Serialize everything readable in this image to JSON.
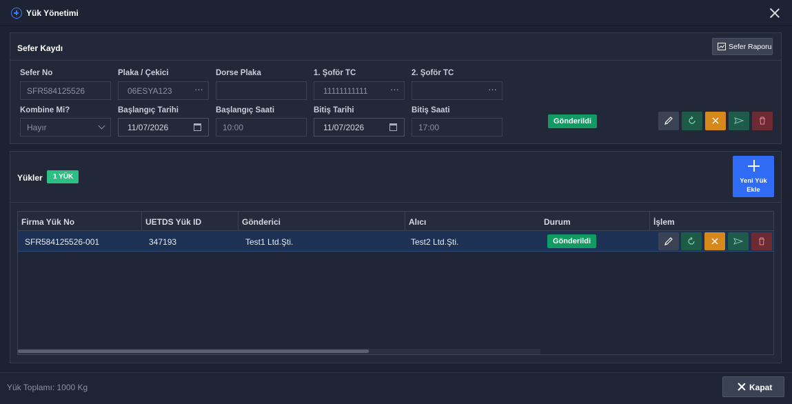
{
  "window": {
    "title": "Yük Yönetimi",
    "icon": "plus-circle-icon"
  },
  "sefer": {
    "section_title": "Sefer Kaydı",
    "report_button": "Sefer Raporu",
    "fields": {
      "sefer_no": {
        "label": "Sefer No",
        "value": "SFR584125526"
      },
      "plaka": {
        "label": "Plaka / Çekici",
        "value": "06ESYA123"
      },
      "dorse": {
        "label": "Dorse Plaka",
        "value": ""
      },
      "sofor1": {
        "label": "1. Şoför TC",
        "value": "11111111111"
      },
      "sofor2": {
        "label": "2. Şoför TC",
        "value": ""
      },
      "kombine": {
        "label": "Kombine Mi?",
        "value": "Hayır"
      },
      "bas_tarih": {
        "label": "Başlangıç Tarihi",
        "value": "11/07/2026"
      },
      "bas_saat": {
        "label": "Başlangıç Saati",
        "value": "10:00"
      },
      "bit_tarih": {
        "label": "Bitiş Tarihi",
        "value": "11/07/2026"
      },
      "bit_saat": {
        "label": "Bitiş Saati",
        "value": "17:00"
      }
    },
    "status": "Gönderildi"
  },
  "yukler": {
    "section_title": "Yükler",
    "count_badge": "1 YÜK",
    "new_button": "Yeni Yük Ekle",
    "columns": [
      "Firma Yük No",
      "UETDS Yük ID",
      "Gönderici",
      "Alıcı",
      "Durum",
      "İşlem"
    ],
    "rows": [
      {
        "firma_yuk_no": "SFR584125526-001",
        "uetds_id": "347193",
        "gonderici": "Test1 Ltd.Şti.",
        "alici": "Test2 Ltd.Şti.",
        "durum": "Gönderildi"
      }
    ]
  },
  "footer": {
    "total": "Yük Toplamı: 1000 Kg",
    "close_button": "Kapat"
  },
  "colors": {
    "accent": "#2f6bf5",
    "success": "#119b62",
    "warning": "#d6891a",
    "danger": "#6e2a33"
  }
}
